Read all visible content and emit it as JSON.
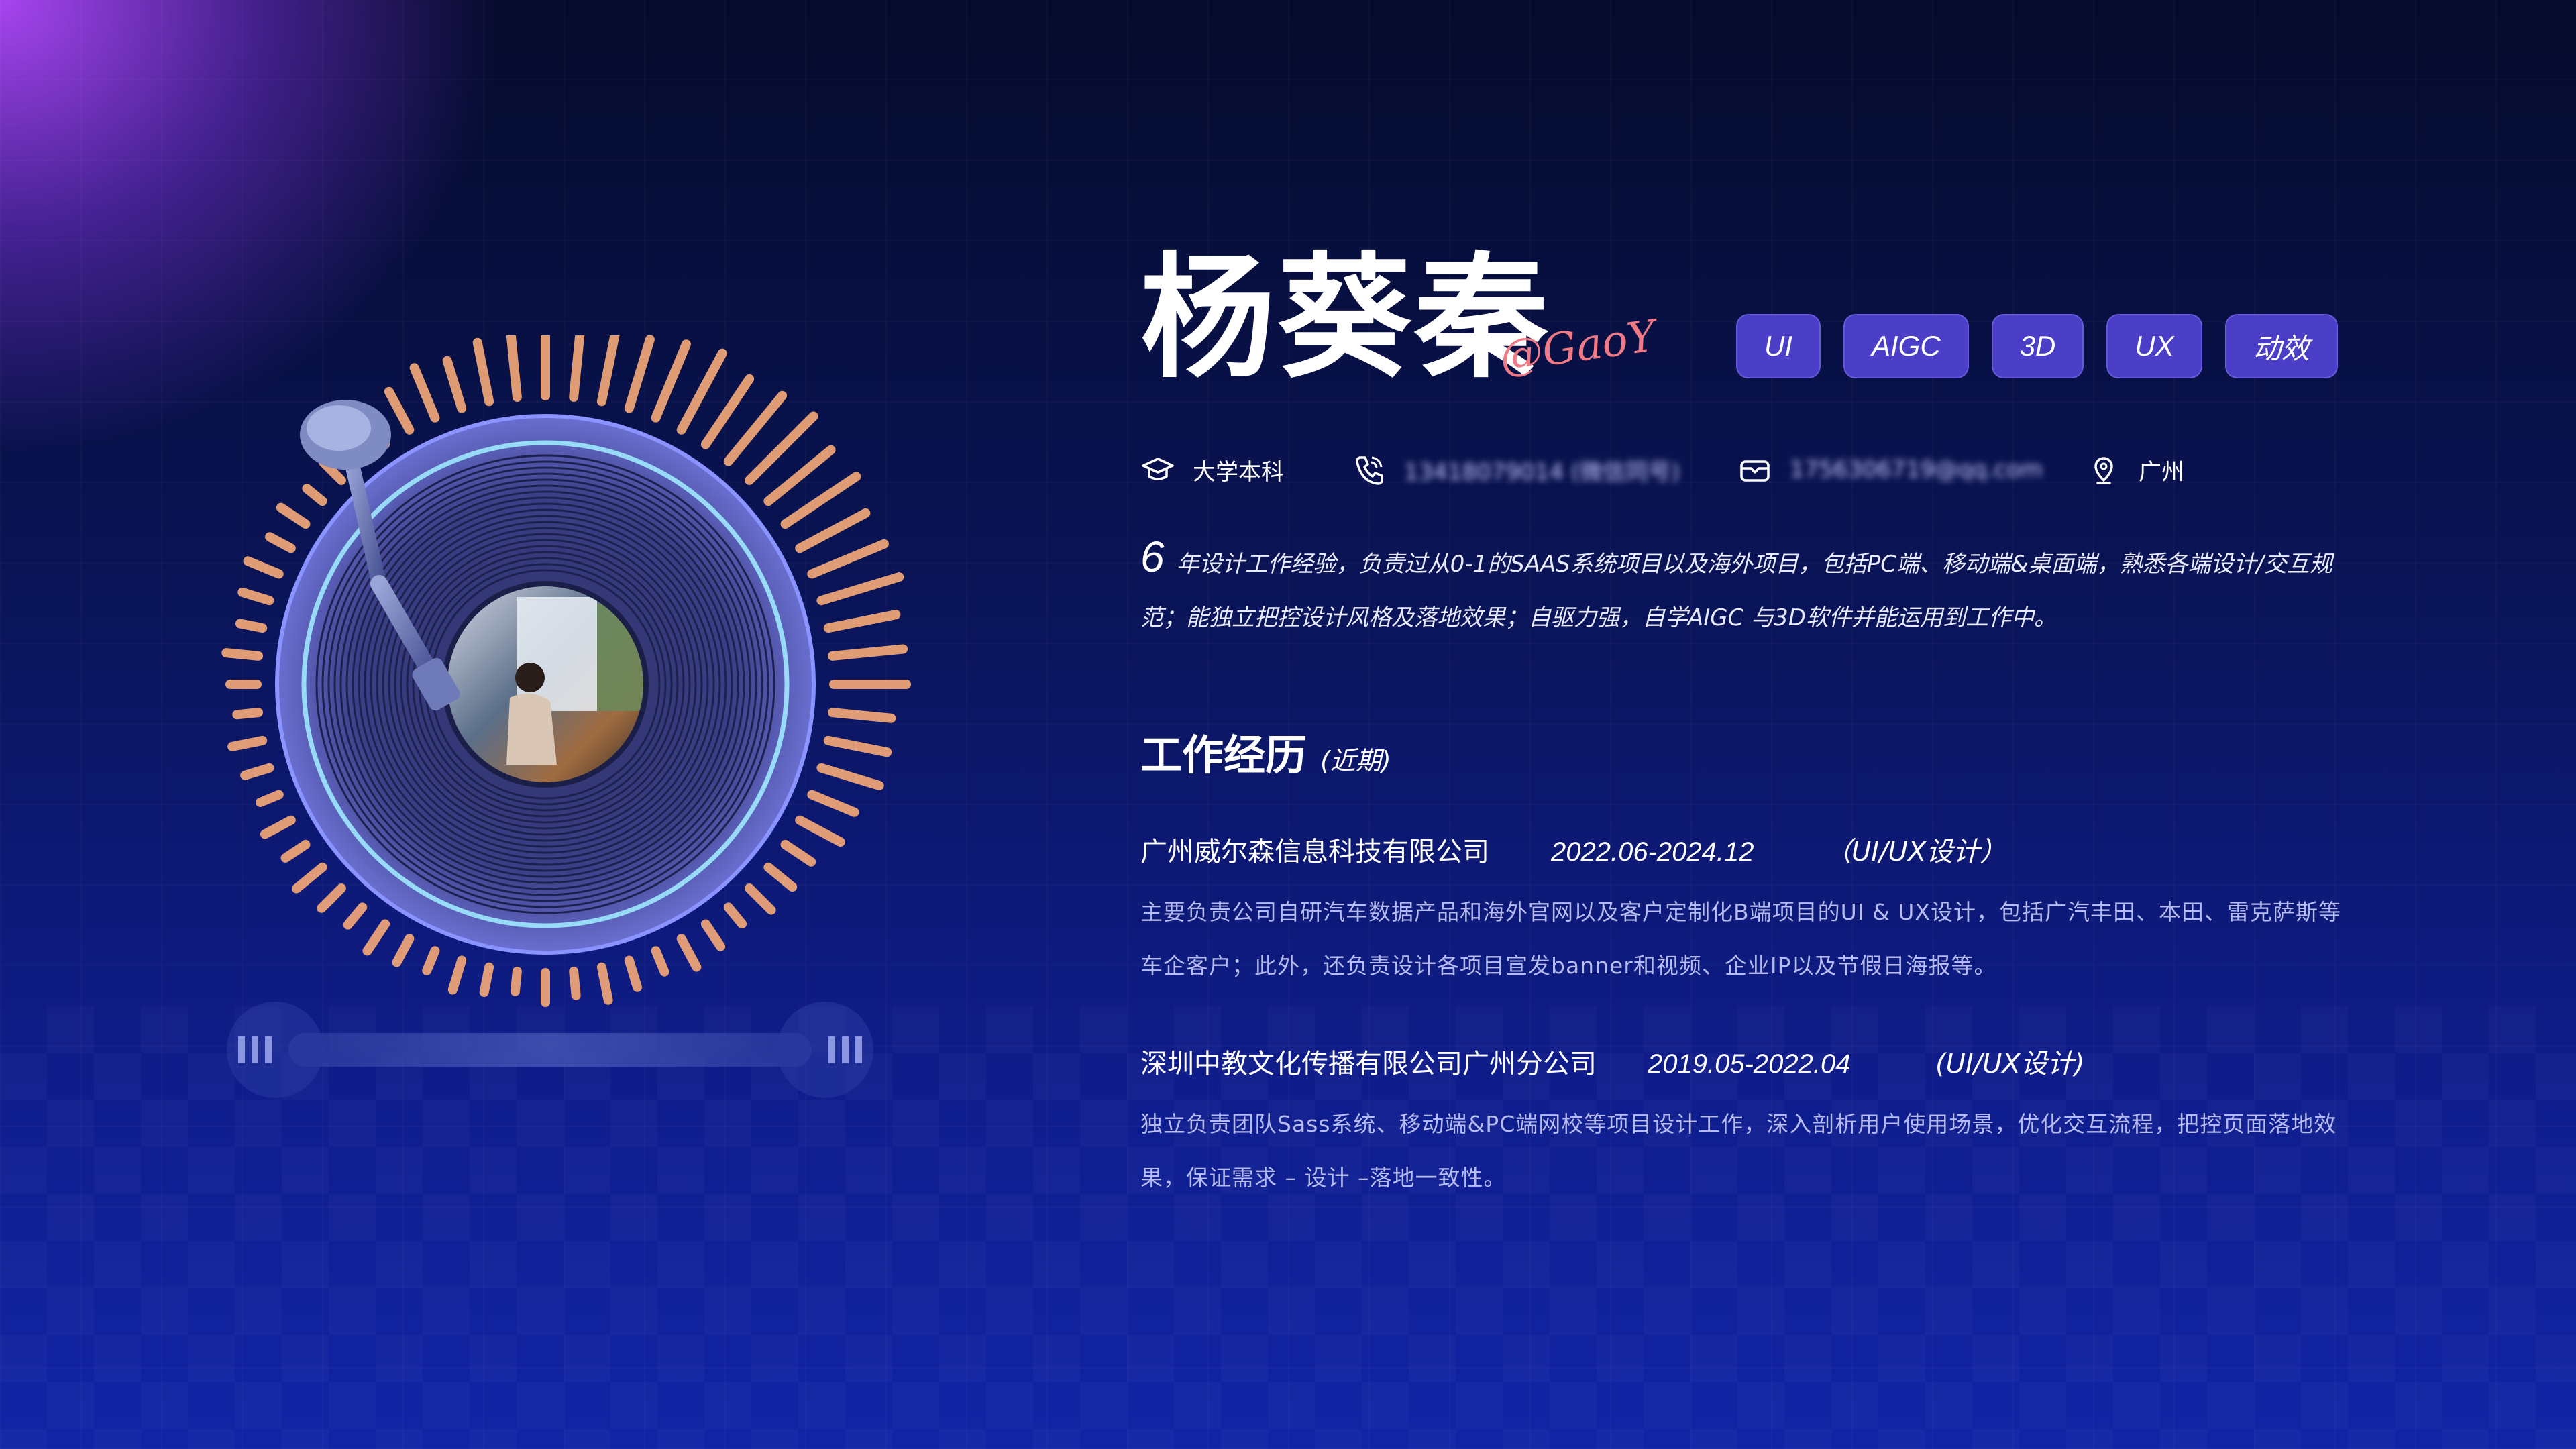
{
  "profile": {
    "name": "杨葵秦",
    "signature": "@GaoY",
    "tags": [
      "UI",
      "AIGC",
      "3D",
      "UX",
      "动效"
    ]
  },
  "contact": {
    "education": "大学本科",
    "phone": "13418079014 (微信同号)",
    "email": "1756306719@qq.com",
    "location": "广州"
  },
  "summary": {
    "years": "6",
    "text": "年设计工作经验，负责过从0-1的SAAS系统项目以及海外项目，包括PC端、移动端&桌面端，熟悉各端设计/交互规范；能独立把控设计风格及落地效果；自驱力强，自学AIGC 与3D软件并能运用到工作中。"
  },
  "experience": {
    "title": "工作经历",
    "subtitle": "(近期)",
    "jobs": [
      {
        "company": "广州威尔森信息科技有限公司",
        "period": "2022.06-2024.12",
        "role": "（UI/UX设计）",
        "description": "主要负责公司自研汽车数据产品和海外官网以及客户定制化B端项目的UI & UX设计，包括广汽丰田、本田、雷克萨斯等车企客户；此外，还负责设计各项目宣发banner和视频、企业IP以及节假日海报等。"
      },
      {
        "company": "深圳中教文化传播有限公司广州分公司",
        "period": "2019.05-2022.04",
        "role": "(UI/UX设计)",
        "description": "独立负责团队Sass系统、移动端&PC端网校等项目设计工作，深入剖析用户使用场景，优化交互流程，把控页面落地效果，保证需求 – 设计 –落地一致性。"
      }
    ]
  },
  "icons": {
    "education": "graduation-cap-icon",
    "phone": "phone-icon",
    "email": "envelope-icon",
    "location": "map-pin-icon"
  },
  "colors": {
    "accent_purple": "#b048fa",
    "tag_bg": "#4a3fc6",
    "bar_orange": "#f2a878",
    "signature": "#f07a86"
  }
}
